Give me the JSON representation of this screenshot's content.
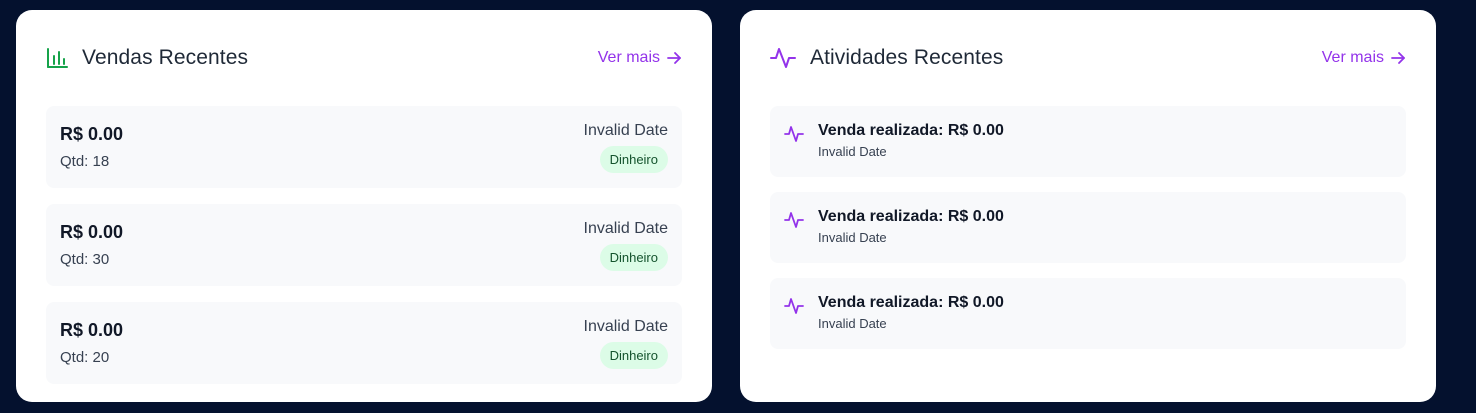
{
  "colors": {
    "background": "#04112e",
    "card": "#ffffff",
    "accent_purple": "#9333ea",
    "sales_icon_green": "#16a34a",
    "badge_bg": "#dcfce7",
    "badge_text": "#14532d",
    "row_bg": "#f8f9fb"
  },
  "sales": {
    "title": "Vendas Recentes",
    "icon": "bar-chart-icon",
    "see_more": "Ver mais",
    "items": [
      {
        "amount": "R$ 0.00",
        "qty": "Qtd: 18",
        "date": "Invalid Date",
        "method": "Dinheiro"
      },
      {
        "amount": "R$ 0.00",
        "qty": "Qtd: 30",
        "date": "Invalid Date",
        "method": "Dinheiro"
      },
      {
        "amount": "R$ 0.00",
        "qty": "Qtd: 20",
        "date": "Invalid Date",
        "method": "Dinheiro"
      }
    ]
  },
  "activity": {
    "title": "Atividades Recentes",
    "icon": "activity-icon",
    "see_more": "Ver mais",
    "items": [
      {
        "title": "Venda realizada: R$ 0.00",
        "date": "Invalid Date"
      },
      {
        "title": "Venda realizada: R$ 0.00",
        "date": "Invalid Date"
      },
      {
        "title": "Venda realizada: R$ 0.00",
        "date": "Invalid Date"
      }
    ]
  }
}
